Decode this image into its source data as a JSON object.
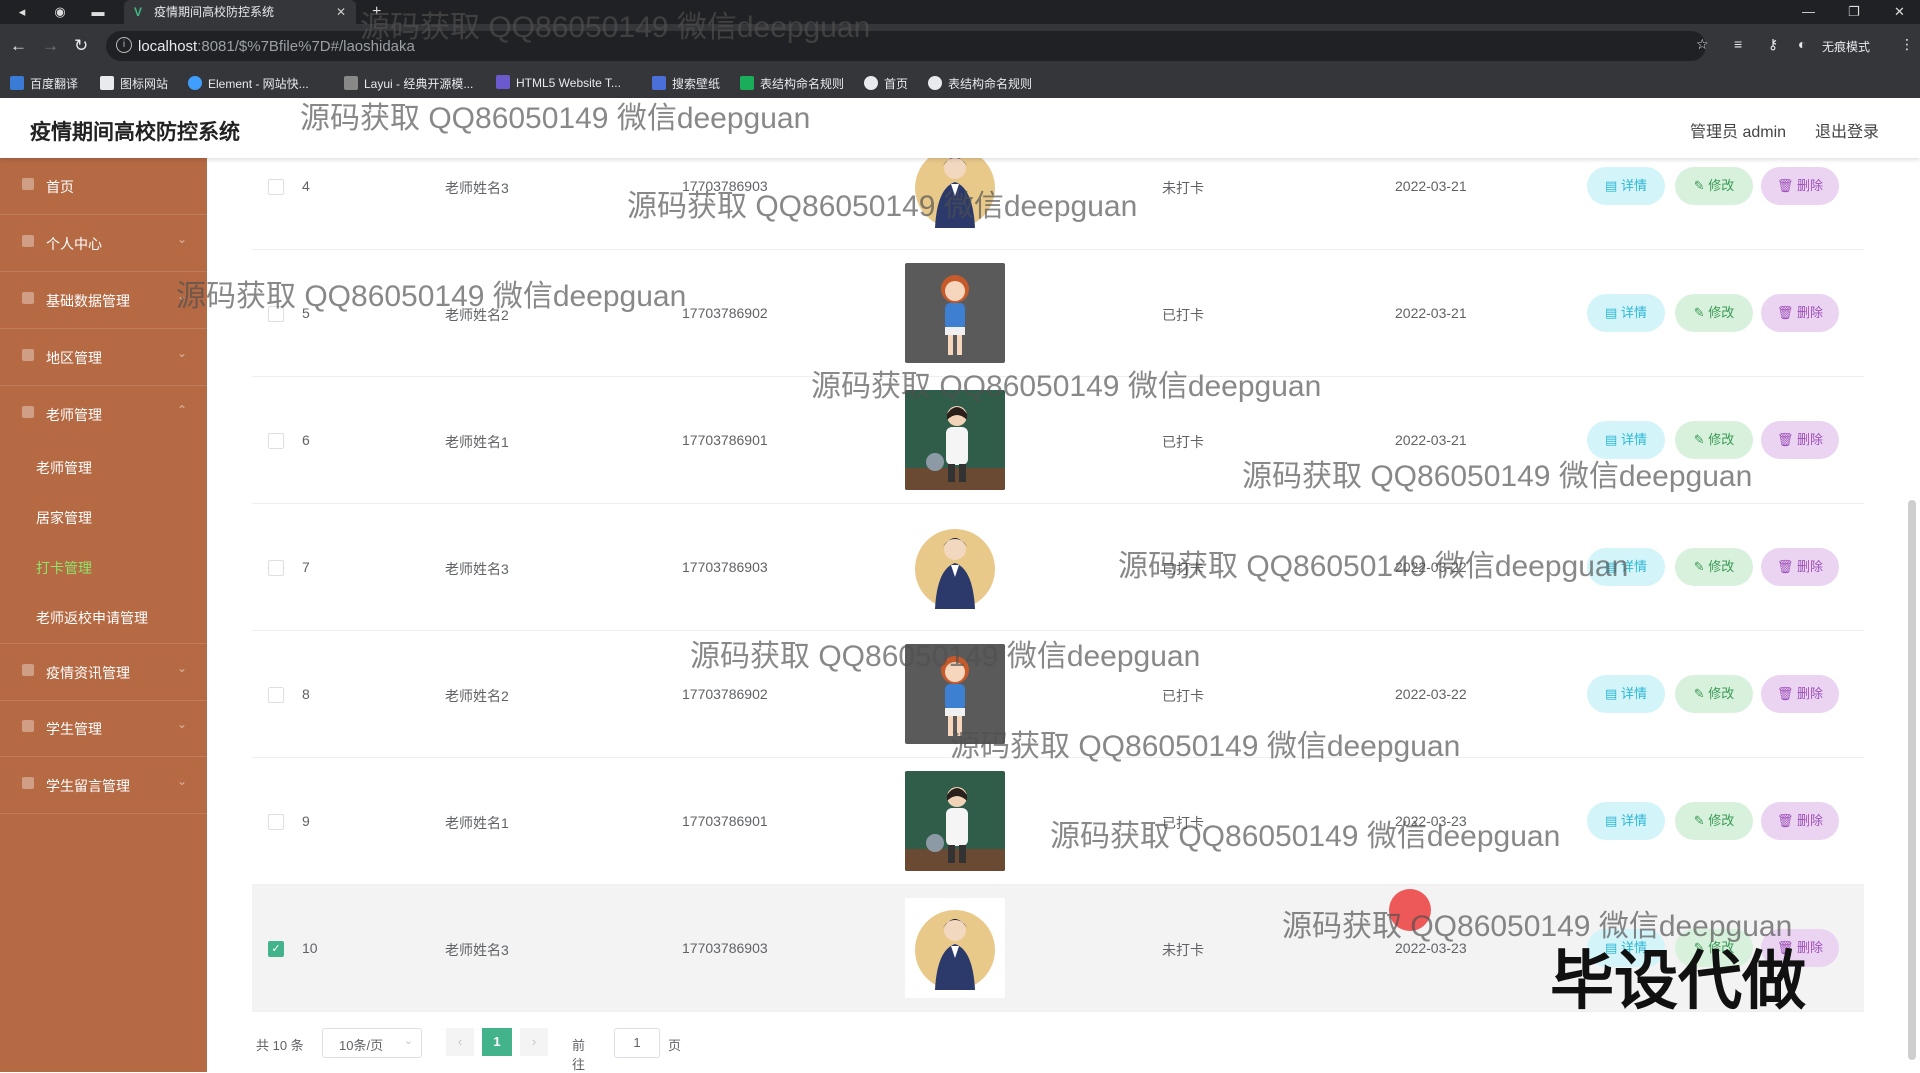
{
  "browser": {
    "tab_title": "疫情期间高校防控系统",
    "url_host": "localhost",
    "url_path": ":8081/$%7Bfile%7D#/laoshidaka",
    "profile": "无痕模式",
    "bookmarks": [
      "百度翻译",
      "图标网站",
      "Element - 网站快...",
      "Layui - 经典开源模...",
      "HTML5 Website T...",
      "搜索壁纸",
      "表结构命名规则",
      "首页",
      "表结构命名规则"
    ]
  },
  "header": {
    "title": "疫情期间高校防控系统",
    "user": "管理员 admin",
    "logout": "退出登录"
  },
  "sidebar": {
    "items": [
      {
        "label": "首页"
      },
      {
        "label": "个人中心"
      },
      {
        "label": "基础数据管理"
      },
      {
        "label": "地区管理"
      },
      {
        "label": "老师管理"
      }
    ],
    "subitems": [
      "老师管理",
      "居家管理",
      "打卡管理",
      "老师返校申请管理"
    ],
    "items_after": [
      {
        "label": "疫情资讯管理"
      },
      {
        "label": "学生管理"
      },
      {
        "label": "学生留言管理"
      }
    ]
  },
  "table": {
    "actions": {
      "detail": "详情",
      "edit": "修改",
      "delete": "删除"
    },
    "rows": [
      {
        "index": "4",
        "name": "老师姓名3",
        "phone": "17703786903",
        "photo": "avatar-3",
        "status": "未打卡",
        "date": "2022-03-21",
        "checked": false
      },
      {
        "index": "5",
        "name": "老师姓名2",
        "phone": "17703786902",
        "photo": "avatar-2",
        "status": "已打卡",
        "date": "2022-03-21",
        "checked": false
      },
      {
        "index": "6",
        "name": "老师姓名1",
        "phone": "17703786901",
        "photo": "avatar-1",
        "status": "已打卡",
        "date": "2022-03-21",
        "checked": false
      },
      {
        "index": "7",
        "name": "老师姓名3",
        "phone": "17703786903",
        "photo": "avatar-3",
        "status": "已打卡",
        "date": "2022-03-22",
        "checked": false
      },
      {
        "index": "8",
        "name": "老师姓名2",
        "phone": "17703786902",
        "photo": "avatar-2",
        "status": "已打卡",
        "date": "2022-03-22",
        "checked": false
      },
      {
        "index": "9",
        "name": "老师姓名1",
        "phone": "17703786901",
        "photo": "avatar-1",
        "status": "已打卡",
        "date": "2022-03-23",
        "checked": false
      },
      {
        "index": "10",
        "name": "老师姓名3",
        "phone": "17703786903",
        "photo": "avatar-3",
        "status": "未打卡",
        "date": "2022-03-23",
        "checked": true
      }
    ]
  },
  "pagination": {
    "total": "共 10 条",
    "page_size": "10条/页",
    "current": "1",
    "goto_label": "前往",
    "goto_value": "1",
    "page_unit": "页"
  },
  "overlay": {
    "watermark": "源码获取 QQ86050149 微信deepguan",
    "stamp": "毕设代做"
  },
  "colors": {
    "sidebar": "#b56a44",
    "accent": "#43b38c",
    "active_menu": "#8fe36a"
  }
}
